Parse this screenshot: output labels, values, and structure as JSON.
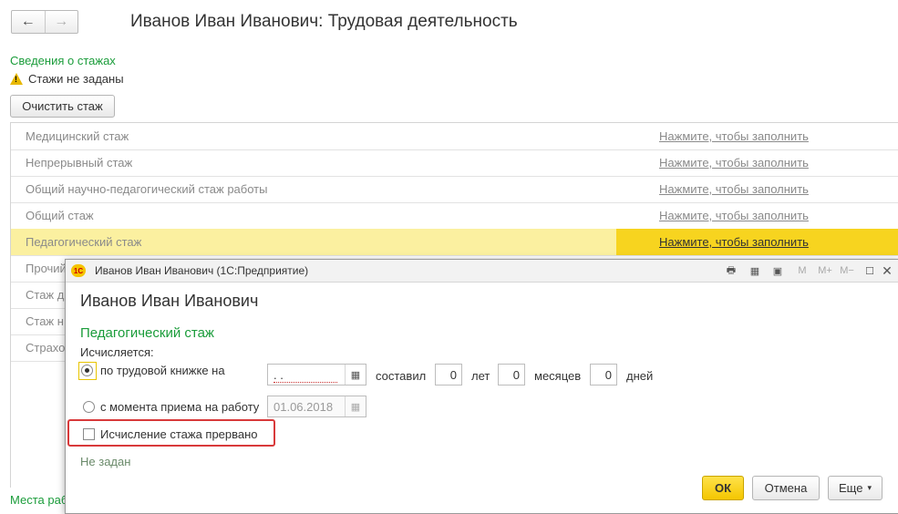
{
  "page": {
    "title": "Иванов Иван Иванович: Трудовая деятельность",
    "back_icon": "←",
    "forward_icon": "→",
    "section_title": "Сведения о стажах",
    "warning_text": "Стажи не заданы",
    "clear_button": "Очистить стаж",
    "rows": [
      {
        "label": "Медицинский стаж",
        "link": "Нажмите, чтобы заполнить"
      },
      {
        "label": "Непрерывный стаж",
        "link": "Нажмите, чтобы заполнить"
      },
      {
        "label": "Общий научно-педагогический стаж работы",
        "link": "Нажмите, чтобы заполнить"
      },
      {
        "label": "Общий стаж",
        "link": "Нажмите, чтобы заполнить"
      },
      {
        "label": "Педагогический стаж",
        "link": "Нажмите, чтобы заполнить"
      },
      {
        "label": "Прочий"
      },
      {
        "label": "Стаж д"
      },
      {
        "label": "Стаж н"
      },
      {
        "label": "Страхо"
      }
    ],
    "places_label": "Места раб"
  },
  "dialog": {
    "window_title": "Иванов Иван Иванович  (1С:Предприятие)",
    "logo_text": "1С",
    "toolbar": {
      "m": "M",
      "m_plus": "M+",
      "m_minus": "M−"
    },
    "heading": "Иванов Иван Иванович",
    "section": "Педагогический стаж",
    "calculated_label": "Исчисляется:",
    "option1_label": "по трудовой книжке на",
    "option1_date": " .  .",
    "amount_label": "составил",
    "years_value": "0",
    "years_label": "лет",
    "months_value": "0",
    "months_label": "месяцев",
    "days_value": "0",
    "days_label": "дней",
    "option2_label": "с момента приема на работу",
    "option2_date": "01.06.2018",
    "interrupted_label": "Исчисление стажа прервано",
    "not_set": "Не задан",
    "ok_button": "ОК",
    "cancel_button": "Отмена",
    "more_button": "Еще"
  },
  "colors": {
    "accent_green": "#1a9c3a",
    "highlight_yellow": "#f7d41f",
    "row_selected": "#fbf0a0",
    "callout_red": "#d8393a"
  }
}
